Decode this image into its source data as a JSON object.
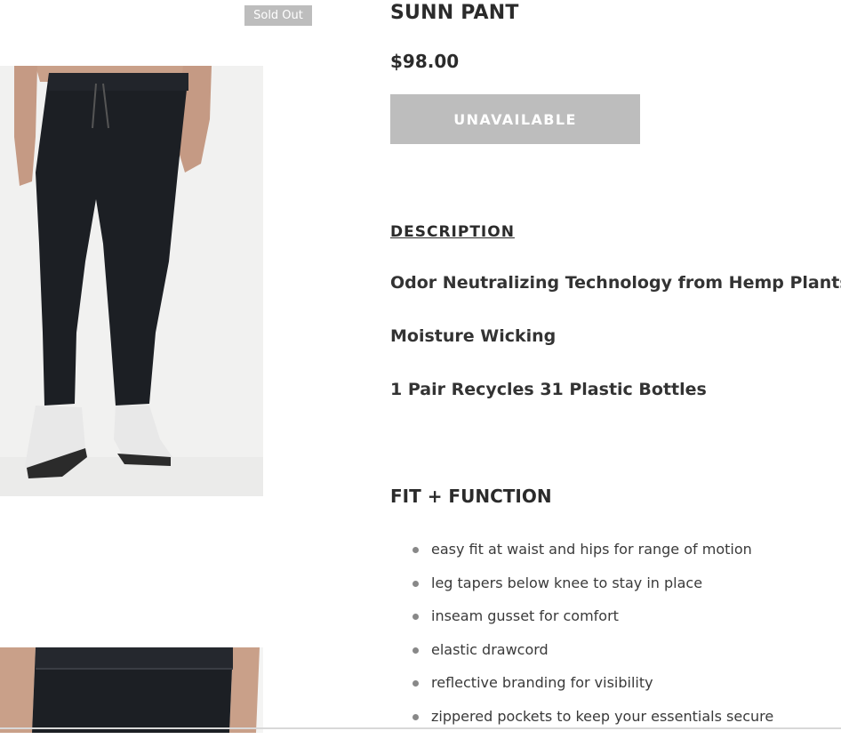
{
  "product": {
    "badge": "Sold Out",
    "title": "SUNN PANT",
    "price": "$98.00",
    "button_label": "UNAVAILABLE"
  },
  "description": {
    "heading": "DESCRIPTION",
    "features": [
      "Odor Neutralizing Technology from Hemp Plants",
      "Moisture Wicking",
      "1 Pair Recycles 31 Plastic Bottles"
    ]
  },
  "fit_function": {
    "heading": "FIT + FUNCTION",
    "items": [
      "easy fit at waist and hips for range of motion",
      "leg tapers below knee to stay in place",
      "inseam gusset for comfort",
      "elastic drawcord",
      "reflective branding for visibility",
      "zippered pockets to keep your essentials secure"
    ]
  },
  "images": [
    "product-photo-front",
    "product-photo-waist-detail"
  ],
  "colors": {
    "badge_bg": "#bdbdbd",
    "button_bg": "#bdbdbd",
    "text": "#333333"
  }
}
